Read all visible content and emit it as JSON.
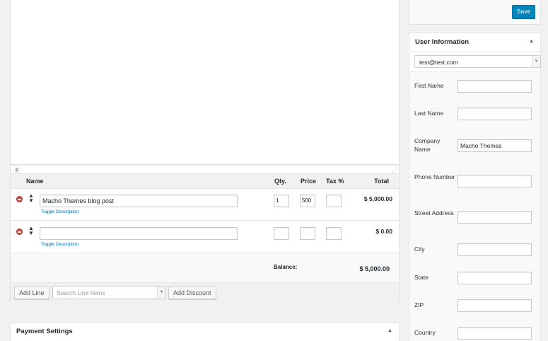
{
  "editor": {
    "path": "p"
  },
  "items": {
    "headers": {
      "name": "Name",
      "qty": "Qty.",
      "price": "Price",
      "tax": "Tax %",
      "total": "Total"
    },
    "rows": [
      {
        "name": "Macho Themes blog post",
        "qty": "1",
        "price": "500",
        "tax": "",
        "total": "$ 5,000.00",
        "toggle": "Toggle Description"
      },
      {
        "name": "",
        "qty": "",
        "price": "",
        "tax": "",
        "total": "$ 0.00",
        "toggle": "Toggle Description"
      }
    ],
    "balance_label": "Balance:",
    "balance_value": "$ 5,000.00",
    "add_line": "Add Line",
    "search_placeholder": "Search Line Items",
    "add_discount": "Add Discount"
  },
  "payment": {
    "title": "Payment Settings"
  },
  "save": {
    "label": "Save"
  },
  "user": {
    "title": "User Information",
    "selected": "test@test.com",
    "fields": [
      {
        "label": "First Name",
        "value": ""
      },
      {
        "label": "Last Name",
        "value": ""
      },
      {
        "label": "Company Name",
        "value": "Macho Themes"
      },
      {
        "label": "Phone Number",
        "value": ""
      },
      {
        "label": "Street Address",
        "value": ""
      },
      {
        "label": "City",
        "value": ""
      },
      {
        "label": "State",
        "value": ""
      },
      {
        "label": "ZIP",
        "value": ""
      },
      {
        "label": "Country",
        "value": ""
      }
    ]
  },
  "colors": {
    "primary": "#0085ba",
    "link": "#0073aa",
    "delete": "#d24b46"
  }
}
